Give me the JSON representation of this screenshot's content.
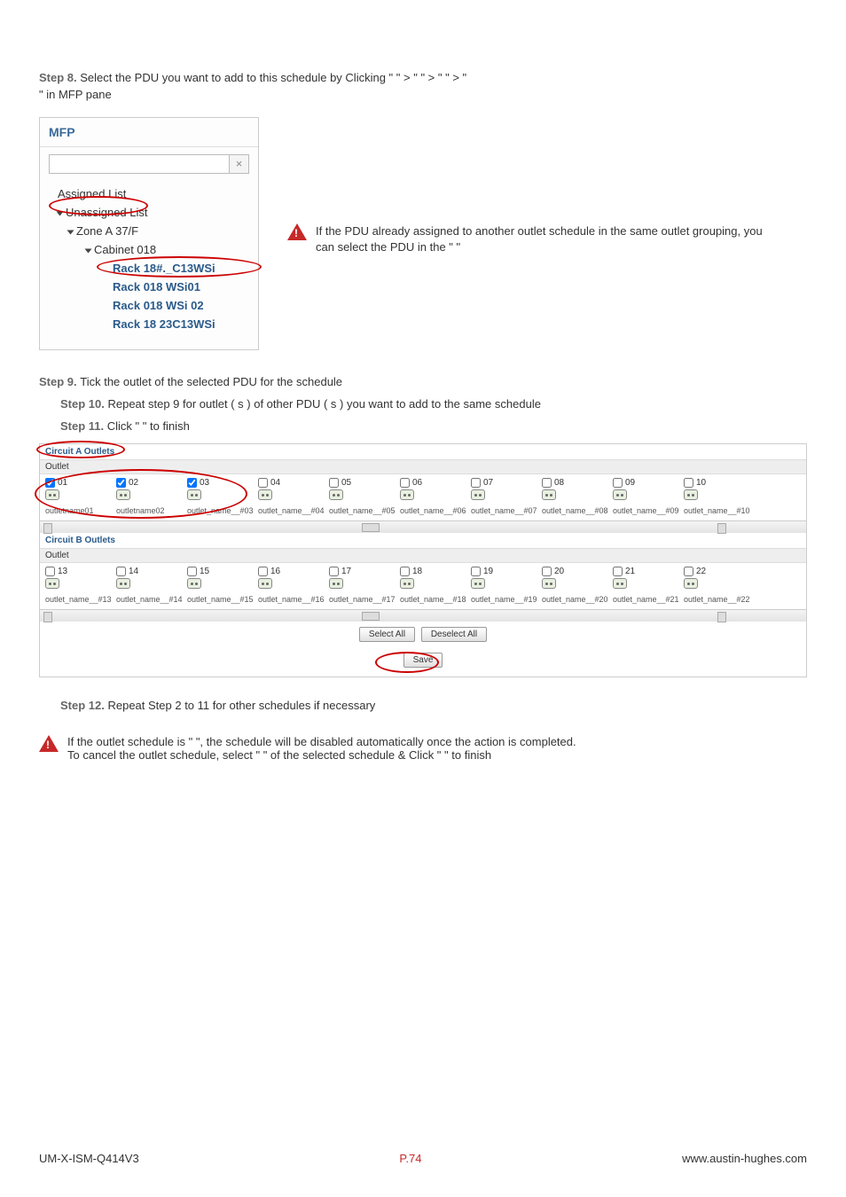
{
  "step8": {
    "prefix": "Step 8. ",
    "text_a": "Select the PDU you want to add to this schedule by Clicking \" ",
    "text_b": " \" > \" ",
    "text_c": " \" > \" ",
    "text_d": " \" > \" ",
    "text_e": " \" in MFP pane"
  },
  "mfp": {
    "title": "MFP",
    "clear": "×",
    "tree": {
      "assigned": "Assigned List",
      "unassigned": "Unassigned List",
      "zone": "Zone A 37/F",
      "cabinet": "Cabinet 018",
      "rack1": "Rack 18#._C13WSi",
      "rack2": "Rack 018 WSi01",
      "rack3": "Rack 018 WSi 02",
      "rack4": "Rack 18 23C13WSi"
    }
  },
  "side_note": "If the PDU already assigned to another outlet schedule in the same outlet grouping, you can select the PDU in the \"                     \"",
  "step9": {
    "prefix": "Step 9. ",
    "text": "Tick the outlet of the selected PDU for the schedule"
  },
  "step10": {
    "prefix": "Step 10. ",
    "text": "Repeat step 9 for outlet ( s ) of other PDU ( s ) you want to add to the same schedule"
  },
  "step11": {
    "prefix": "Step 11. ",
    "text_a": "Click \" ",
    "text_b": " \" to finish"
  },
  "outlets": {
    "circuitA": "Circuit A Outlets",
    "circuitB": "Circuit B Outlets",
    "band": "Outlet",
    "rowA": [
      {
        "num": "01",
        "checked": true
      },
      {
        "num": "02",
        "checked": true
      },
      {
        "num": "03",
        "checked": true
      },
      {
        "num": "04",
        "checked": false
      },
      {
        "num": "05",
        "checked": false
      },
      {
        "num": "06",
        "checked": false
      },
      {
        "num": "07",
        "checked": false
      },
      {
        "num": "08",
        "checked": false
      },
      {
        "num": "09",
        "checked": false
      },
      {
        "num": "10",
        "checked": false
      }
    ],
    "namesA": [
      "outletname01",
      "outletname02",
      "outlet_name__#03",
      "outlet_name__#04",
      "outlet_name__#05",
      "outlet_name__#06",
      "outlet_name__#07",
      "outlet_name__#08",
      "outlet_name__#09",
      "outlet_name__#10"
    ],
    "rowB": [
      {
        "num": "13",
        "checked": false
      },
      {
        "num": "14",
        "checked": false
      },
      {
        "num": "15",
        "checked": false
      },
      {
        "num": "16",
        "checked": false
      },
      {
        "num": "17",
        "checked": false
      },
      {
        "num": "18",
        "checked": false
      },
      {
        "num": "19",
        "checked": false
      },
      {
        "num": "20",
        "checked": false
      },
      {
        "num": "21",
        "checked": false
      },
      {
        "num": "22",
        "checked": false
      }
    ],
    "namesB": [
      "outlet_name__#13",
      "outlet_name__#14",
      "outlet_name__#15",
      "outlet_name__#16",
      "outlet_name__#17",
      "outlet_name__#18",
      "outlet_name__#19",
      "outlet_name__#20",
      "outlet_name__#21",
      "outlet_name__#22"
    ],
    "select_all": "Select All",
    "deselect_all": "Deselect All",
    "save": "Save"
  },
  "step12": {
    "prefix": "Step 12. ",
    "text": "Repeat Step 2 to 11 for other schedules if necessary"
  },
  "final": {
    "line1_a": "If the outlet schedule is \" ",
    "line1_b": " \", the schedule will be disabled automatically once the action is completed.",
    "line2_a": "To cancel the outlet schedule,  select \" ",
    "line2_b": " \" of the selected schedule & Click \" ",
    "line2_c": " \" to finish"
  },
  "footer": {
    "left": "UM-X-ISM-Q414V3",
    "center": "P.74",
    "right": "www.austin-hughes.com"
  }
}
